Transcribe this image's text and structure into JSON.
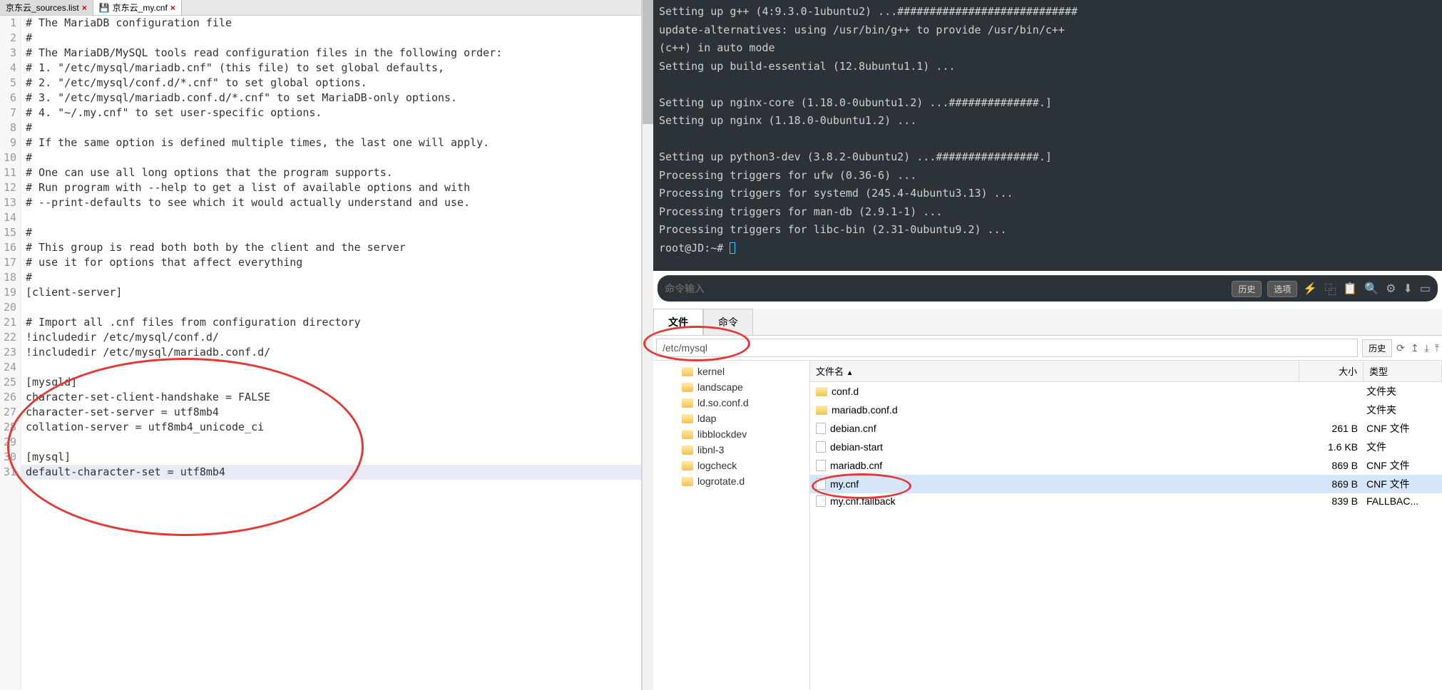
{
  "tabs": [
    {
      "label": "京东云_sources.list",
      "icon": "file"
    },
    {
      "label": "京东云_my.cnf",
      "icon": "disk",
      "active": true
    }
  ],
  "editor": {
    "lines": [
      "# The MariaDB configuration file",
      "#",
      "# The MariaDB/MySQL tools read configuration files in the following order:",
      "# 1. \"/etc/mysql/mariadb.cnf\" (this file) to set global defaults,",
      "# 2. \"/etc/mysql/conf.d/*.cnf\" to set global options.",
      "# 3. \"/etc/mysql/mariadb.conf.d/*.cnf\" to set MariaDB-only options.",
      "# 4. \"~/.my.cnf\" to set user-specific options.",
      "#",
      "# If the same option is defined multiple times, the last one will apply.",
      "#",
      "# One can use all long options that the program supports.",
      "# Run program with --help to get a list of available options and with",
      "# --print-defaults to see which it would actually understand and use.",
      "",
      "#",
      "# This group is read both both by the client and the server",
      "# use it for options that affect everything",
      "#",
      "[client-server]",
      "",
      "# Import all .cnf files from configuration directory",
      "!includedir /etc/mysql/conf.d/",
      "!includedir /etc/mysql/mariadb.conf.d/",
      "",
      "[mysqld]",
      "character-set-client-handshake = FALSE",
      "character-set-server = utf8mb4",
      "collation-server = utf8mb4_unicode_ci",
      "",
      "[mysql]",
      "default-character-set = utf8mb4"
    ]
  },
  "terminal": {
    "lines": [
      "Setting up g++ (4:9.3.0-1ubuntu2) ...############################",
      "update-alternatives: using /usr/bin/g++ to provide /usr/bin/c++",
      "(c++) in auto mode",
      "Setting up build-essential (12.8ubuntu1.1) ...",
      "",
      "Setting up nginx-core (1.18.0-0ubuntu1.2) ...##############.]",
      "Setting up nginx (1.18.0-0ubuntu1.2) ...",
      "",
      "Setting up python3-dev (3.8.2-0ubuntu2) ...################.]",
      "Processing triggers for ufw (0.36-6) ...",
      "Processing triggers for systemd (245.4-4ubuntu3.13) ...",
      "Processing triggers for man-db (2.9.1-1) ...",
      "Processing triggers for libc-bin (2.31-0ubuntu9.2) ...",
      "root@JD:~# "
    ]
  },
  "cmdBar": {
    "placeholder": "命令输入",
    "history": "历史",
    "options": "选项"
  },
  "fileTabs": {
    "files": "文件",
    "commands": "命令"
  },
  "pathBar": {
    "path": "/etc/mysql",
    "history": "历史"
  },
  "fileHeader": {
    "name": "文件名",
    "size": "大小",
    "type": "类型"
  },
  "folderTree": [
    "kernel",
    "landscape",
    "ld.so.conf.d",
    "ldap",
    "libblockdev",
    "libnl-3",
    "logcheck",
    "logrotate.d"
  ],
  "fileList": [
    {
      "name": "conf.d",
      "size": "",
      "type": "文件夹",
      "kind": "folder"
    },
    {
      "name": "mariadb.conf.d",
      "size": "",
      "type": "文件夹",
      "kind": "folder"
    },
    {
      "name": "debian.cnf",
      "size": "261 B",
      "type": "CNF 文件",
      "kind": "file"
    },
    {
      "name": "debian-start",
      "size": "1.6 KB",
      "type": "文件",
      "kind": "file"
    },
    {
      "name": "mariadb.cnf",
      "size": "869 B",
      "type": "CNF 文件",
      "kind": "file"
    },
    {
      "name": "my.cnf",
      "size": "869 B",
      "type": "CNF 文件",
      "kind": "file",
      "selected": true
    },
    {
      "name": "my.cnf.fallback",
      "size": "839 B",
      "type": "FALLBAC...",
      "kind": "file"
    }
  ]
}
